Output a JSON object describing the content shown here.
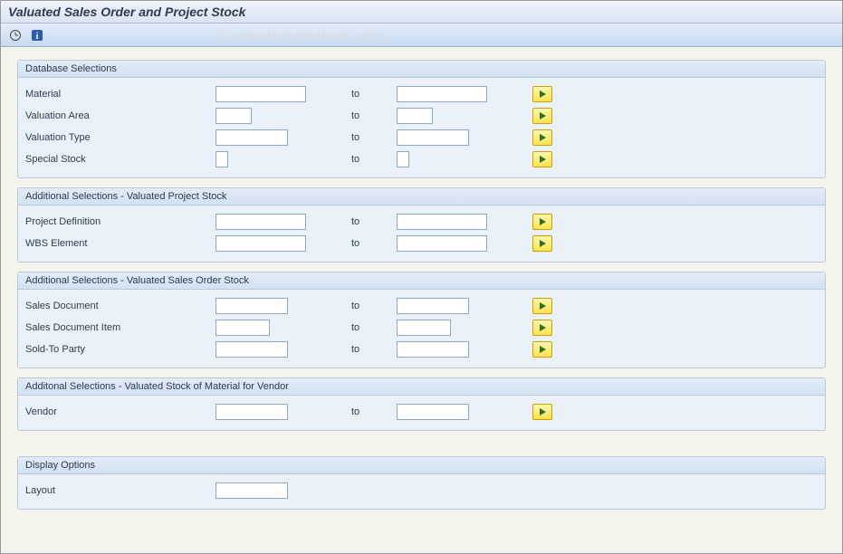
{
  "title": "Valuated Sales Order and Project Stock",
  "watermark": "© www.tutorialkart.com",
  "to_label": "to",
  "groups": {
    "db": {
      "header": "Database Selections",
      "material": "Material",
      "valuation_area": "Valuation Area",
      "valuation_type": "Valuation Type",
      "special_stock": "Special Stock"
    },
    "proj": {
      "header": "Additional Selections - Valuated Project Stock",
      "project_definition": "Project Definition",
      "wbs_element": "WBS Element"
    },
    "sales": {
      "header": "Additional Selections - Valuated Sales Order Stock",
      "sales_document": "Sales Document",
      "sales_document_item": "Sales Document Item",
      "sold_to_party": "Sold-To Party"
    },
    "vendor": {
      "header": "Additonal Selections - Valuated Stock of Material for Vendor",
      "vendor": "Vendor"
    },
    "display": {
      "header": "Display Options",
      "layout": "Layout"
    }
  }
}
